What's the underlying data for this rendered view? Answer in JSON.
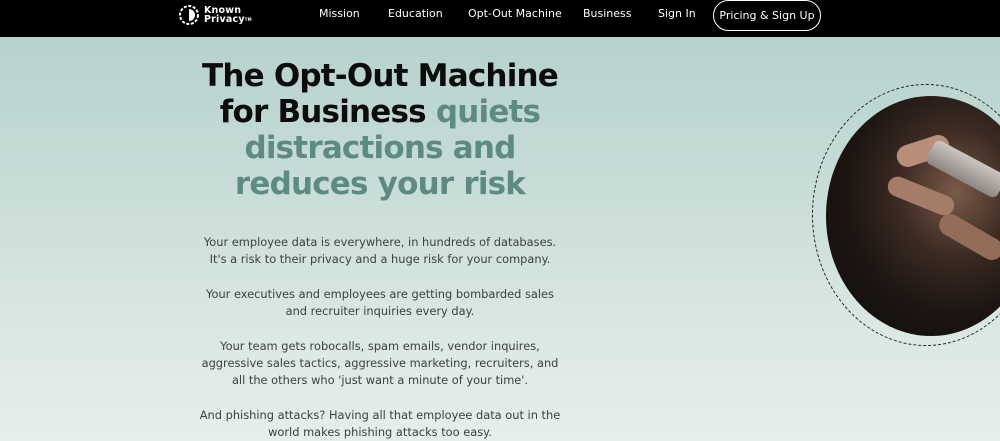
{
  "brand": {
    "line1": "Known",
    "line2": "Privacy",
    "tm": "TM"
  },
  "nav": {
    "items": [
      "Mission",
      "Education",
      "Opt-Out Machine",
      "Business",
      "Sign In"
    ],
    "cta": "Pricing & Sign Up"
  },
  "hero": {
    "title_plain_1": "The Opt-Out Machine",
    "title_plain_2": "for Business",
    "title_accent_1": "quiets",
    "title_accent_2": "distractions and",
    "title_accent_3": "reduces your risk"
  },
  "body": {
    "p1": "Your employee data is everywhere, in hundreds of databases. It's a risk to their privacy and a huge risk for your company.",
    "p2": "Your executives and employees are getting bombarded sales and recruiter inquiries every day.",
    "p3": "Your team gets robocalls, spam emails, vendor inquires, aggressive sales tactics, aggressive marketing, recruiters, and all the others who 'just want a minute of your time'.",
    "p4": "And phishing attacks? Having all that employee data out in the world makes phishing attacks too easy."
  },
  "colors": {
    "accent": "#5e8b81",
    "topbar": "#000000"
  }
}
